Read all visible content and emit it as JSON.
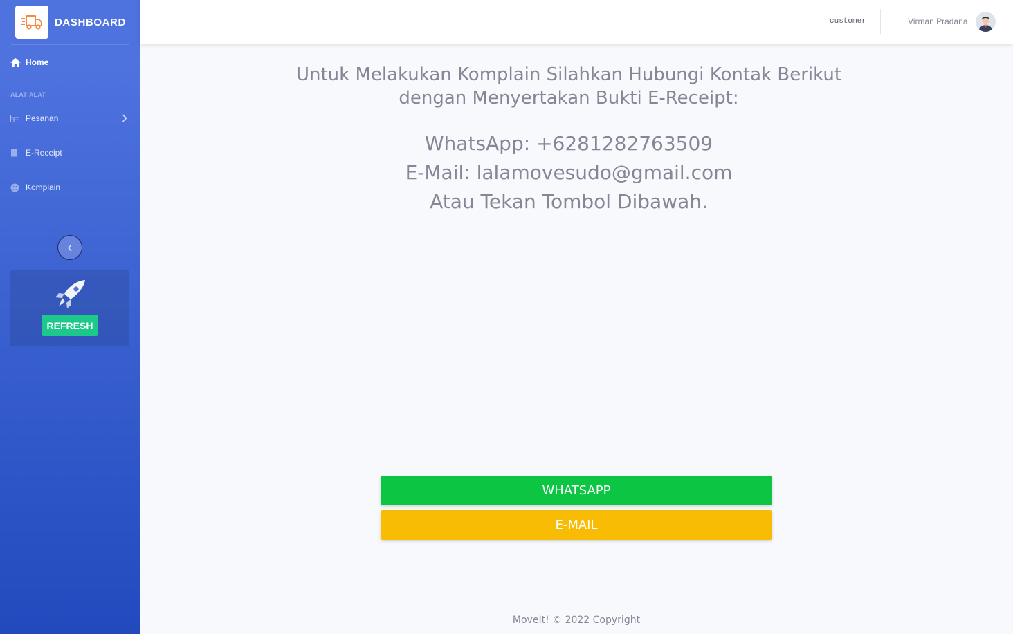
{
  "sidebar": {
    "brand": "DASHBOARD",
    "logo_icon": "truck-icon",
    "home_label": "Home",
    "heading": "ALAT-ALAT",
    "items": [
      {
        "label": "Pesanan",
        "icon": "table-icon"
      },
      {
        "label": "E-Receipt",
        "icon": "receipt-icon"
      },
      {
        "label": "Komplain",
        "icon": "face-icon"
      }
    ],
    "refresh_label": "REFRESH"
  },
  "topbar": {
    "role": "customer",
    "username": "Virman Pradana"
  },
  "main": {
    "instruction": "Untuk Melakukan Komplain Silahkan Hubungi Kontak Berikut dengan Menyertakan Bukti E-Receipt:",
    "whatsapp_line": "WhatsApp: +6281282763509",
    "email_line": "E-Mail: lalamovesudo@gmail.com",
    "hint_line": "Atau Tekan Tombol Dibawah.",
    "whatsapp_button": "WHATSAPP",
    "email_button": "E-MAIL"
  },
  "footer": {
    "copyright": "MoveIt! © 2022 Copyright"
  },
  "colors": {
    "sidebar_top": "#4e73df",
    "sidebar_bottom": "#224abe",
    "whatsapp": "#0bc543",
    "email": "#f9bc05",
    "refresh": "#1cc88a"
  }
}
